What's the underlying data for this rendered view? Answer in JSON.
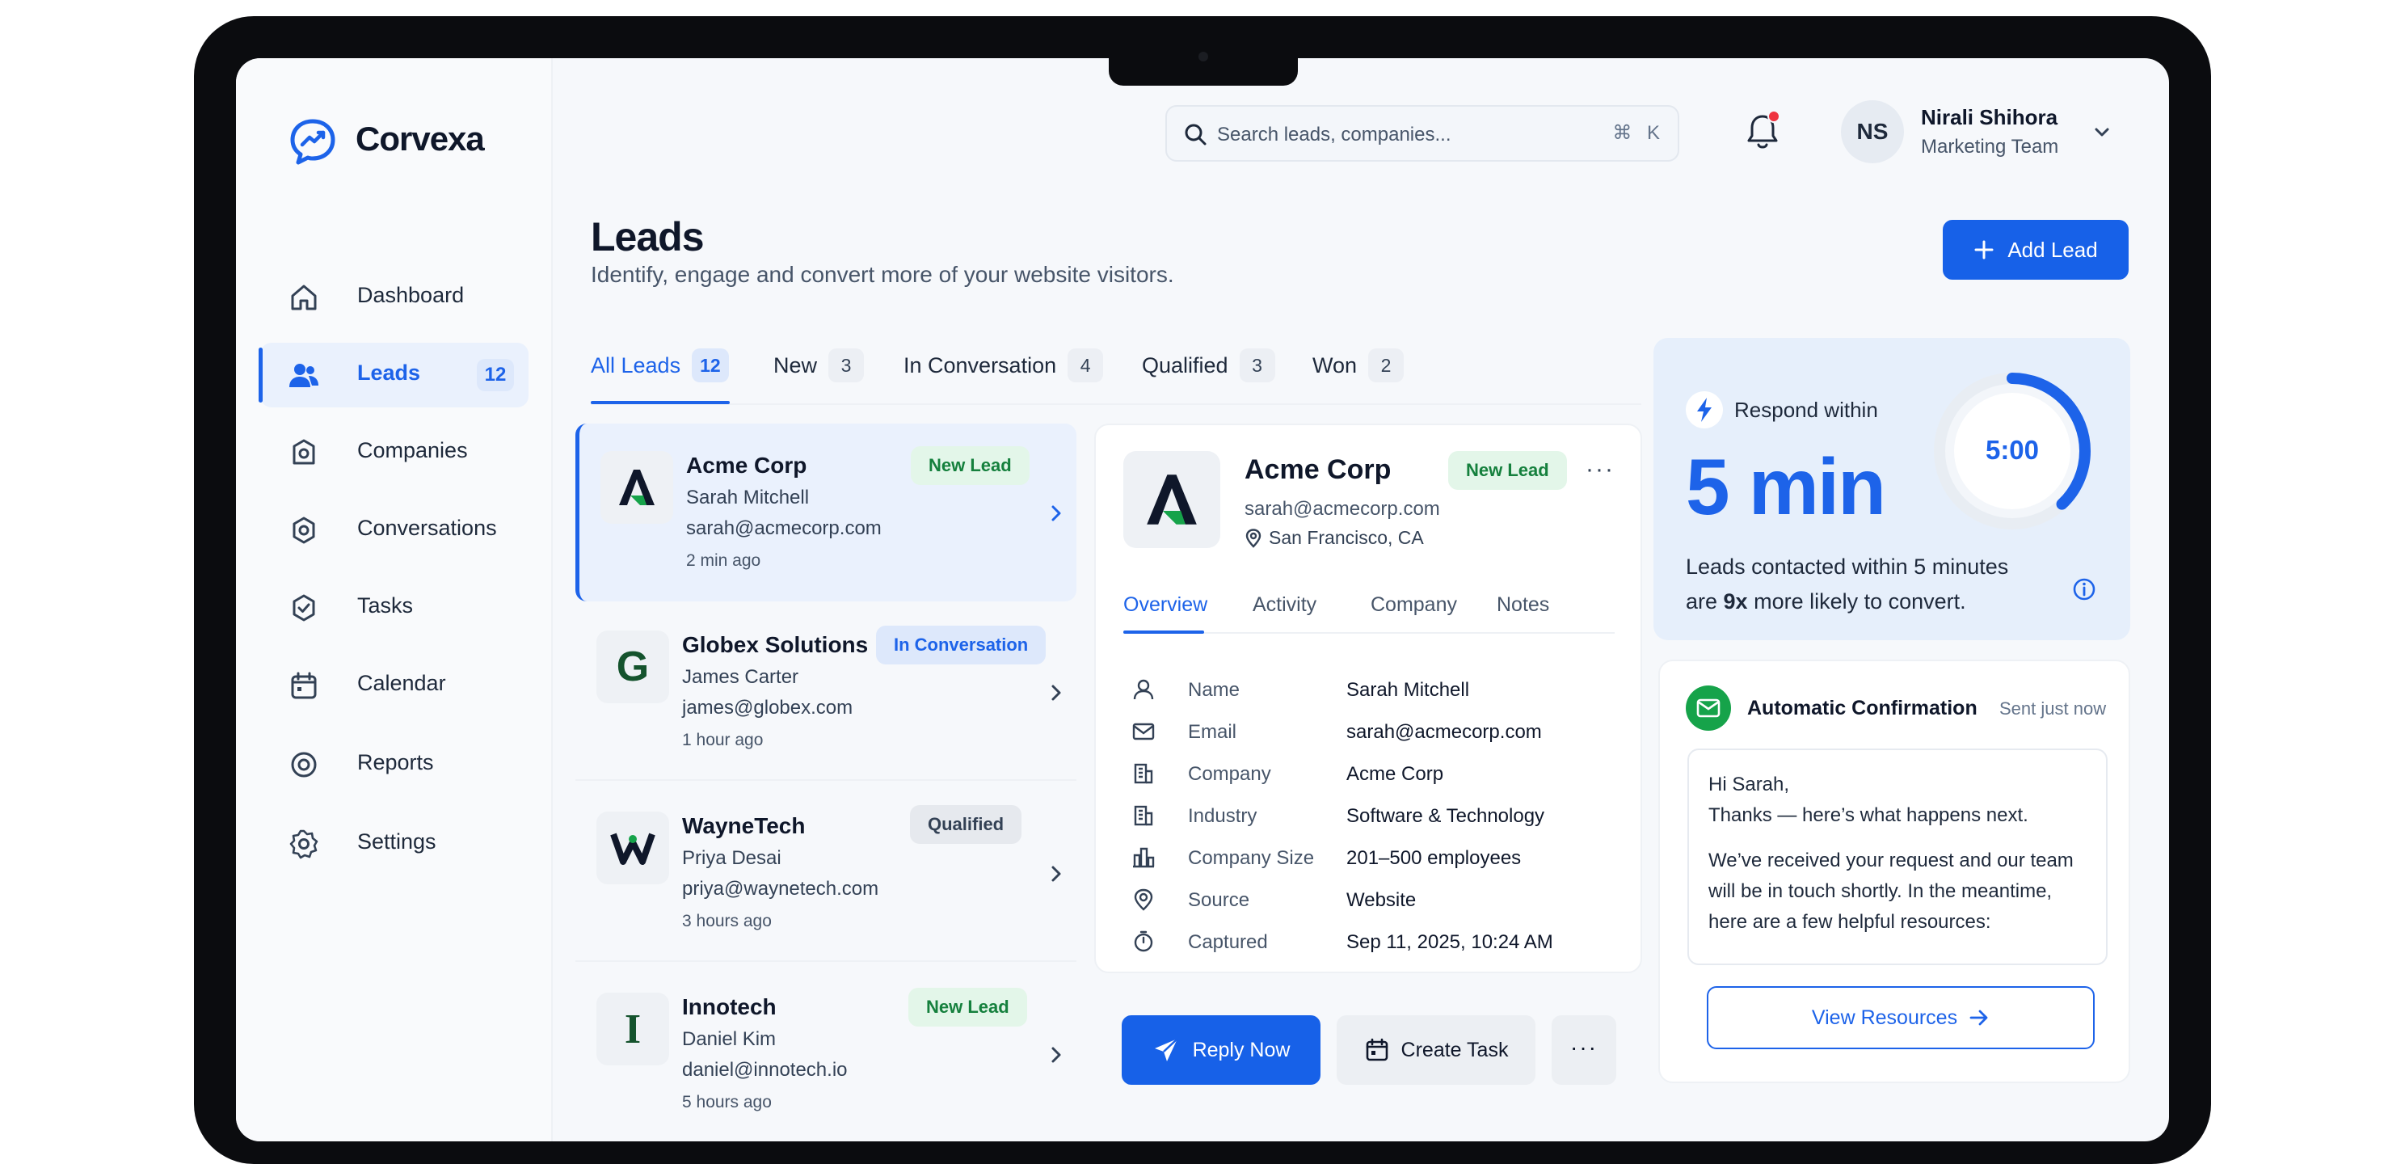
{
  "brand": {
    "name": "Corvexa"
  },
  "sidebar": {
    "items": [
      {
        "label": "Dashboard",
        "icon": "home-icon"
      },
      {
        "label": "Leads",
        "icon": "users-icon",
        "badge": "12",
        "active": true
      },
      {
        "label": "Companies",
        "icon": "building-icon"
      },
      {
        "label": "Conversations",
        "icon": "chat-icon"
      },
      {
        "label": "Tasks",
        "icon": "check-square-icon"
      },
      {
        "label": "Calendar",
        "icon": "calendar-icon"
      },
      {
        "label": "Reports",
        "icon": "target-icon"
      },
      {
        "label": "Settings",
        "icon": "gear-icon"
      }
    ]
  },
  "header": {
    "search_placeholder": "Search leads, companies...",
    "search_shortcut": "⌘ K",
    "user": {
      "initials": "NS",
      "name": "Nirali Shihora",
      "team": "Marketing Team"
    }
  },
  "page": {
    "title": "Leads",
    "subtitle": "Identify, engage and convert more of your website visitors.",
    "add_label": "Add Lead"
  },
  "tabs": [
    {
      "label": "All Leads",
      "count": "12",
      "active": true
    },
    {
      "label": "New",
      "count": "3"
    },
    {
      "label": "In Conversation",
      "count": "4"
    },
    {
      "label": "Qualified",
      "count": "3"
    },
    {
      "label": "Won",
      "count": "2"
    }
  ],
  "leads": [
    {
      "company": "Acme Corp",
      "person": "Sarah Mitchell",
      "email": "sarah@acmecorp.com",
      "time": "2 min ago",
      "status": "New Lead",
      "logo": "A"
    },
    {
      "company": "Globex Solutions",
      "person": "James Carter",
      "email": "james@globex.com",
      "time": "1 hour ago",
      "status": "In Conversation",
      "logo": "G"
    },
    {
      "company": "WayneTech",
      "person": "Priya Desai",
      "email": "priya@waynetech.com",
      "time": "3 hours ago",
      "status": "Qualified",
      "logo": "W"
    },
    {
      "company": "Innotech",
      "person": "Daniel Kim",
      "email": "daniel@innotech.io",
      "time": "5 hours ago",
      "status": "New Lead",
      "logo": "I"
    }
  ],
  "detail": {
    "company": "Acme Corp",
    "status": "New Lead",
    "email": "sarah@acmecorp.com",
    "location": "San Francisco, CA",
    "logo": "A",
    "tabs": [
      "Overview",
      "Activity",
      "Company",
      "Notes"
    ],
    "fields": [
      {
        "key": "Name",
        "value": "Sarah Mitchell"
      },
      {
        "key": "Email",
        "value": "sarah@acmecorp.com"
      },
      {
        "key": "Company",
        "value": "Acme Corp"
      },
      {
        "key": "Industry",
        "value": "Software & Technology"
      },
      {
        "key": "Company Size",
        "value": "201–500 employees"
      },
      {
        "key": "Source",
        "value": "Website"
      },
      {
        "key": "Captured",
        "value": "Sep 11, 2025, 10:24 AM"
      }
    ],
    "actions": {
      "reply": "Reply Now",
      "task": "Create Task",
      "more": "···",
      "menu": "···"
    }
  },
  "respond": {
    "label": "Respond within",
    "big": "5 min",
    "timer": "5:00",
    "text_before": "Leads contacted within 5 minutes are ",
    "text_bold": "9x",
    "text_after": " more likely to convert.",
    "ring_progress": 0.38
  },
  "confirmation": {
    "title": "Automatic Confirmation",
    "time": "Sent just now",
    "greeting": "Hi Sarah,",
    "line1": "Thanks — here’s what happens next.",
    "line2": "We’ve received your request and our team will be in touch shortly. In the meantime, here are a few helpful resources:",
    "button": "View Resources"
  },
  "colors": {
    "accent": "#1d63e9",
    "new": "#15803d",
    "success": "#16a34a",
    "alert": "#ef3340"
  }
}
